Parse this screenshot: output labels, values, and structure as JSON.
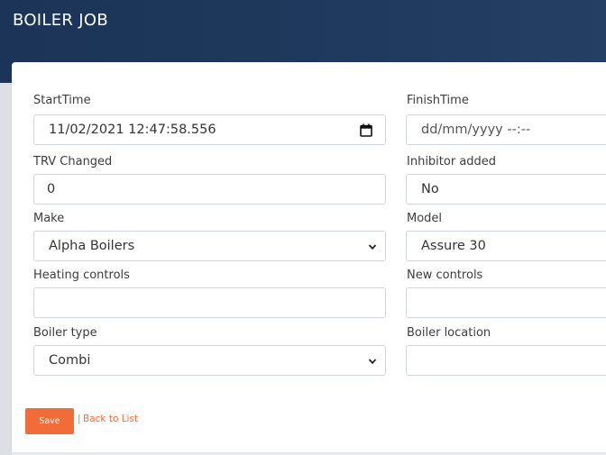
{
  "app": {
    "title": "BOILER JOB"
  },
  "form": {
    "start_time": {
      "label": "StartTime",
      "value": "11/02/2021 12:47:58.556"
    },
    "finish_time": {
      "label": "FinishTime",
      "placeholder": "dd/mm/yyyy --:--"
    },
    "trv_changed": {
      "label": "TRV Changed",
      "value": "0"
    },
    "inhibitor_added": {
      "label": "Inhibitor added",
      "value": "No"
    },
    "make": {
      "label": "Make",
      "selected": "Alpha Boilers"
    },
    "model": {
      "label": "Model",
      "value": "Assure 30"
    },
    "heating_controls": {
      "label": "Heating controls",
      "value": ""
    },
    "new_controls": {
      "label": "New controls",
      "value": ""
    },
    "boiler_type": {
      "label": "Boiler type",
      "selected": "Combi"
    },
    "boiler_location": {
      "label": "Boiler location",
      "value": ""
    }
  },
  "actions": {
    "save_label": "Save",
    "separator": "|",
    "back_label": "Back to List"
  },
  "icons": {
    "calendar": "calendar-icon",
    "select_arrow": "chevron-down-icon"
  },
  "colors": {
    "header": "#1b3457",
    "accent": "#f26c3a"
  }
}
